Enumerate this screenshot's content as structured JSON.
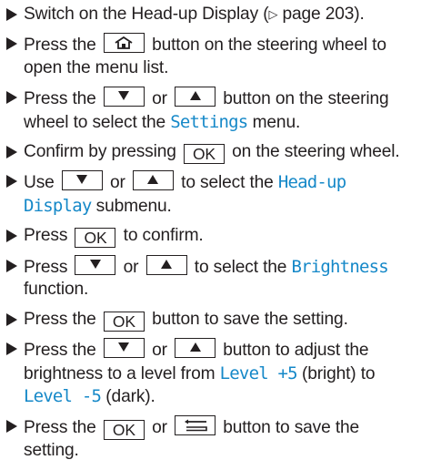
{
  "steps": [
    {
      "t1": "Switch on the Head-up Display (",
      "ref": "▷",
      "t2": " page 203)."
    },
    {
      "t1": "Press the ",
      "key": "home-icon",
      "t2": " button on the steering wheel to open the menu list."
    },
    {
      "t1": "Press the ",
      "or": " or ",
      "t2": " button on the steering wheel to select the ",
      "menu": "Settings",
      "t3": " menu."
    },
    {
      "t1": "Confirm by pressing ",
      "key": "OK",
      "t2": " on the steering wheel."
    },
    {
      "t1": "Use ",
      "or": " or ",
      "t2": " to select the ",
      "menu": "Head-up Display",
      "t3": " submenu."
    },
    {
      "t1": "Press ",
      "key": "OK",
      "t2": " to confirm."
    },
    {
      "t1": "Press ",
      "or": " or ",
      "t2": " to select the ",
      "menu": "Brightness",
      "t3": " function."
    },
    {
      "t1": "Press the ",
      "key": "OK",
      "t2": " button to save the setting."
    },
    {
      "t1": "Press the ",
      "or": " or ",
      "t2": " button to adjust the brightness to a level from ",
      "level1": "Level +5",
      "t3": " (bright) to ",
      "level2": "Level -5",
      "t4": " (dark)."
    },
    {
      "t1": "Press the ",
      "key": "OK",
      "or": " or ",
      "t2": " button to save the setting."
    }
  ],
  "colors": {
    "text": "#231f20",
    "menu": "#1588c8"
  },
  "icons": [
    "triangle-bullet-icon",
    "home-icon",
    "down-arrow-icon",
    "up-arrow-icon",
    "back-icon"
  ]
}
